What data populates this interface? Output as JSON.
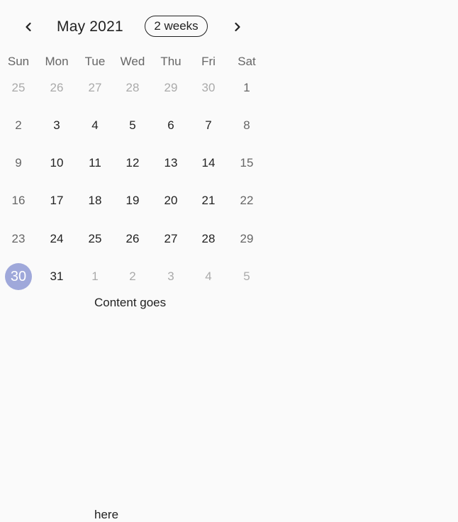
{
  "header": {
    "prev_icon": "chevron-left-icon",
    "next_icon": "chevron-right-icon",
    "month_title": "May 2021",
    "format_button": "2 weeks"
  },
  "days_of_week": [
    "Sun",
    "Mon",
    "Tue",
    "Wed",
    "Thu",
    "Fri",
    "Sat"
  ],
  "weeks": [
    [
      {
        "d": "25",
        "t": "outside"
      },
      {
        "d": "26",
        "t": "outside"
      },
      {
        "d": "27",
        "t": "outside"
      },
      {
        "d": "28",
        "t": "outside"
      },
      {
        "d": "29",
        "t": "outside"
      },
      {
        "d": "30",
        "t": "outside"
      },
      {
        "d": "1",
        "t": "weekend"
      }
    ],
    [
      {
        "d": "2",
        "t": "weekend"
      },
      {
        "d": "3",
        "t": "weekday"
      },
      {
        "d": "4",
        "t": "weekday"
      },
      {
        "d": "5",
        "t": "weekday"
      },
      {
        "d": "6",
        "t": "weekday"
      },
      {
        "d": "7",
        "t": "weekday"
      },
      {
        "d": "8",
        "t": "weekend"
      }
    ],
    [
      {
        "d": "9",
        "t": "weekend"
      },
      {
        "d": "10",
        "t": "weekday"
      },
      {
        "d": "11",
        "t": "weekday"
      },
      {
        "d": "12",
        "t": "weekday"
      },
      {
        "d": "13",
        "t": "weekday"
      },
      {
        "d": "14",
        "t": "weekday"
      },
      {
        "d": "15",
        "t": "weekend"
      }
    ],
    [
      {
        "d": "16",
        "t": "weekend"
      },
      {
        "d": "17",
        "t": "weekday"
      },
      {
        "d": "18",
        "t": "weekday"
      },
      {
        "d": "19",
        "t": "weekday"
      },
      {
        "d": "20",
        "t": "weekday"
      },
      {
        "d": "21",
        "t": "weekday"
      },
      {
        "d": "22",
        "t": "weekend"
      }
    ],
    [
      {
        "d": "23",
        "t": "weekend"
      },
      {
        "d": "24",
        "t": "weekday"
      },
      {
        "d": "25",
        "t": "weekday"
      },
      {
        "d": "26",
        "t": "weekday"
      },
      {
        "d": "27",
        "t": "weekday"
      },
      {
        "d": "28",
        "t": "weekday"
      },
      {
        "d": "29",
        "t": "weekend"
      }
    ],
    [
      {
        "d": "30",
        "t": "selected"
      },
      {
        "d": "31",
        "t": "weekday"
      },
      {
        "d": "1",
        "t": "outside"
      },
      {
        "d": "2",
        "t": "outside"
      },
      {
        "d": "3",
        "t": "outside"
      },
      {
        "d": "4",
        "t": "outside"
      },
      {
        "d": "5",
        "t": "outside"
      }
    ]
  ],
  "selected_day": "30",
  "colors": {
    "selected_bg": "#9fa8da",
    "selected_text": "#ffffff",
    "weekday_text": "#222222",
    "weekend_text": "#666666",
    "outside_text": "#aaaaaa"
  },
  "content": {
    "line1": "Content goes",
    "line2": "here"
  }
}
